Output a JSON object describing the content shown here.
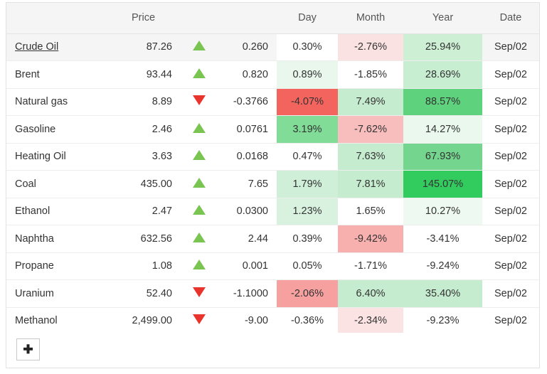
{
  "table": {
    "columns": [
      {
        "key": "name",
        "label": "",
        "align": "left"
      },
      {
        "key": "price",
        "label": "Price",
        "align": "right"
      },
      {
        "key": "arrow",
        "label": "",
        "align": "center"
      },
      {
        "key": "chg",
        "label": "",
        "align": "right"
      },
      {
        "key": "day",
        "label": "Day",
        "align": "center"
      },
      {
        "key": "month",
        "label": "Month",
        "align": "center"
      },
      {
        "key": "year",
        "label": "Year",
        "align": "center"
      },
      {
        "key": "date",
        "label": "Date",
        "align": "center"
      }
    ],
    "rows": [
      {
        "name": "Crude Oil",
        "is_link": true,
        "hover": true,
        "price": "87.26",
        "direction": "up",
        "change": "0.260",
        "day": "0.30%",
        "day_bg": "#ffffff",
        "month": "-2.76%",
        "month_bg": "#fbe2e2",
        "year": "25.94%",
        "year_bg": "#cdf0d5",
        "date": "Sep/02"
      },
      {
        "name": "Brent",
        "is_link": false,
        "hover": false,
        "price": "93.44",
        "direction": "up",
        "change": "0.820",
        "day": "0.89%",
        "day_bg": "#e9f7ec",
        "month": "-1.85%",
        "month_bg": "#ffffff",
        "year": "28.69%",
        "year_bg": "#c7eed1",
        "date": "Sep/02"
      },
      {
        "name": "Natural gas",
        "is_link": false,
        "hover": false,
        "price": "8.89",
        "direction": "down",
        "change": "-0.3766",
        "day": "-4.07%",
        "day_bg": "#f4645f",
        "month": "7.49%",
        "month_bg": "#c6ecd0",
        "year": "88.57%",
        "year_bg": "#5ed27c",
        "date": "Sep/02"
      },
      {
        "name": "Gasoline",
        "is_link": false,
        "hover": false,
        "price": "2.46",
        "direction": "up",
        "change": "0.0761",
        "day": "3.19%",
        "day_bg": "#81dc97",
        "month": "-7.62%",
        "month_bg": "#f8bdbd",
        "year": "14.27%",
        "year_bg": "#eaf8ee",
        "date": "Sep/02"
      },
      {
        "name": "Heating Oil",
        "is_link": false,
        "hover": false,
        "price": "3.63",
        "direction": "up",
        "change": "0.0168",
        "day": "0.47%",
        "day_bg": "#ffffff",
        "month": "7.63%",
        "month_bg": "#c6ecd0",
        "year": "67.93%",
        "year_bg": "#74d68e",
        "date": "Sep/02"
      },
      {
        "name": "Coal",
        "is_link": false,
        "hover": false,
        "price": "435.00",
        "direction": "up",
        "change": "7.65",
        "day": "1.79%",
        "day_bg": "#cfefd8",
        "month": "7.81%",
        "month_bg": "#c6ecd0",
        "year": "145.07%",
        "year_bg": "#32cb5e",
        "date": "Sep/02"
      },
      {
        "name": "Ethanol",
        "is_link": false,
        "hover": false,
        "price": "2.47",
        "direction": "up",
        "change": "0.0300",
        "day": "1.23%",
        "day_bg": "#d9f2e0",
        "month": "1.65%",
        "month_bg": "#ffffff",
        "year": "10.27%",
        "year_bg": "#eef9f1",
        "date": "Sep/02"
      },
      {
        "name": "Naphtha",
        "is_link": false,
        "hover": false,
        "price": "632.56",
        "direction": "up",
        "change": "2.44",
        "day": "0.39%",
        "day_bg": "#ffffff",
        "month": "-9.42%",
        "month_bg": "#f8b0ae",
        "year": "-3.41%",
        "year_bg": "#ffffff",
        "date": "Sep/02"
      },
      {
        "name": "Propane",
        "is_link": false,
        "hover": false,
        "price": "1.08",
        "direction": "up",
        "change": "0.001",
        "day": "0.05%",
        "day_bg": "#ffffff",
        "month": "-1.71%",
        "month_bg": "#ffffff",
        "year": "-9.24%",
        "year_bg": "#ffffff",
        "date": "Sep/02"
      },
      {
        "name": "Uranium",
        "is_link": false,
        "hover": false,
        "price": "52.40",
        "direction": "down",
        "change": "-1.1000",
        "day": "-2.06%",
        "day_bg": "#f6a1a0",
        "month": "6.40%",
        "month_bg": "#c6ecd0",
        "year": "35.40%",
        "year_bg": "#c6ecd0",
        "date": "Sep/02"
      },
      {
        "name": "Methanol",
        "is_link": false,
        "hover": false,
        "price": "2,499.00",
        "direction": "down",
        "change": "-9.00",
        "day": "-0.36%",
        "day_bg": "#ffffff",
        "month": "-2.34%",
        "month_bg": "#fbe3e3",
        "year": "-9.23%",
        "year_bg": "#ffffff",
        "date": "Sep/02"
      }
    ]
  },
  "footer": {
    "add_button_label": "✚"
  },
  "colors": {
    "up_arrow": "#7ac552",
    "down_arrow": "#e8342c",
    "header_bg": "#f5f5f5",
    "row_hover_bg": "#f5f5f5",
    "border": "#e2e2e2",
    "text": "#333333",
    "header_text": "#555555"
  }
}
